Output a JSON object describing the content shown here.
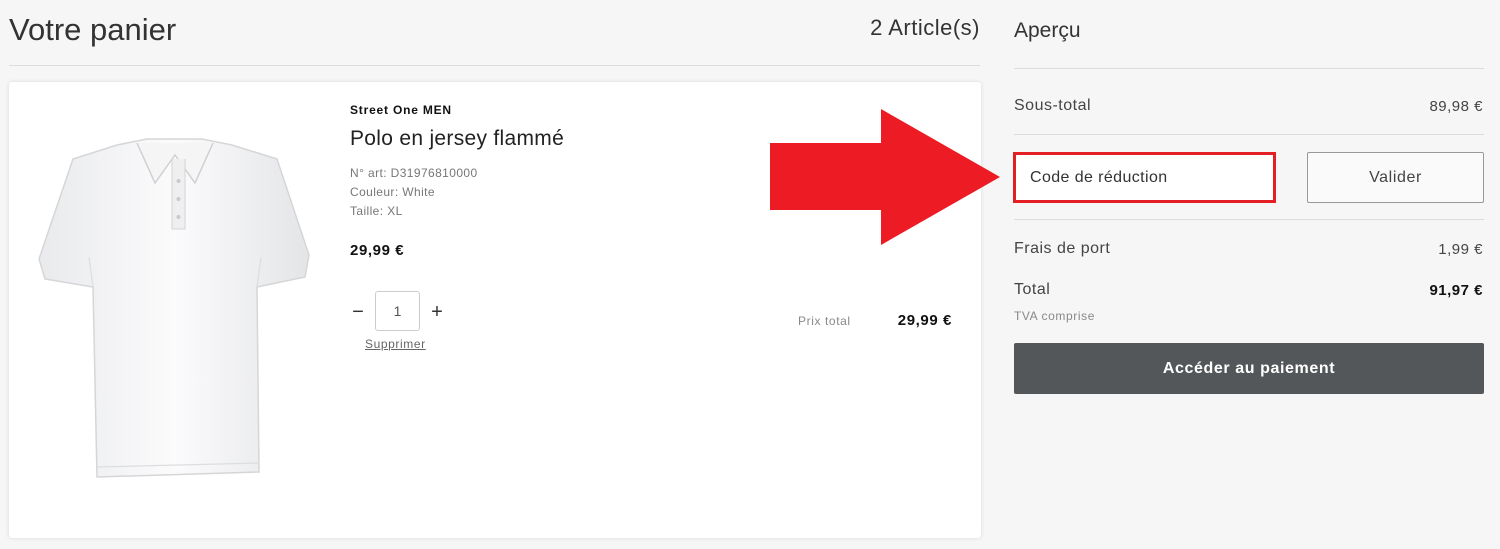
{
  "cart": {
    "title": "Votre panier",
    "item_count": "2 Article(s)"
  },
  "product": {
    "brand": "Street One MEN",
    "name": "Polo en jersey flammé",
    "article_number": "N° art: D31976810000",
    "color": "Couleur: White",
    "size": "Taille: XL",
    "unit_price": "29,99 €",
    "quantity": "1",
    "remove_label": "Supprimer",
    "total_label": "Prix total",
    "total_value": "29,99 €",
    "image_icon": "white-polo-shirt"
  },
  "annotation": {
    "arrow_color": "#e31e24",
    "highlight_color": "#e31e24"
  },
  "summary": {
    "title": "Aperçu",
    "subtotal_label": "Sous-total",
    "subtotal_value": "89,98 €",
    "discount_placeholder": "Code de réduction",
    "validate_label": "Valider",
    "shipping_label": "Frais de port",
    "shipping_value": "1,99 €",
    "total_label": "Total",
    "total_value": "91,97 €",
    "vat_note": "TVA comprise",
    "checkout_label": "Accéder au paiement",
    "checkout_color": "#545759"
  }
}
